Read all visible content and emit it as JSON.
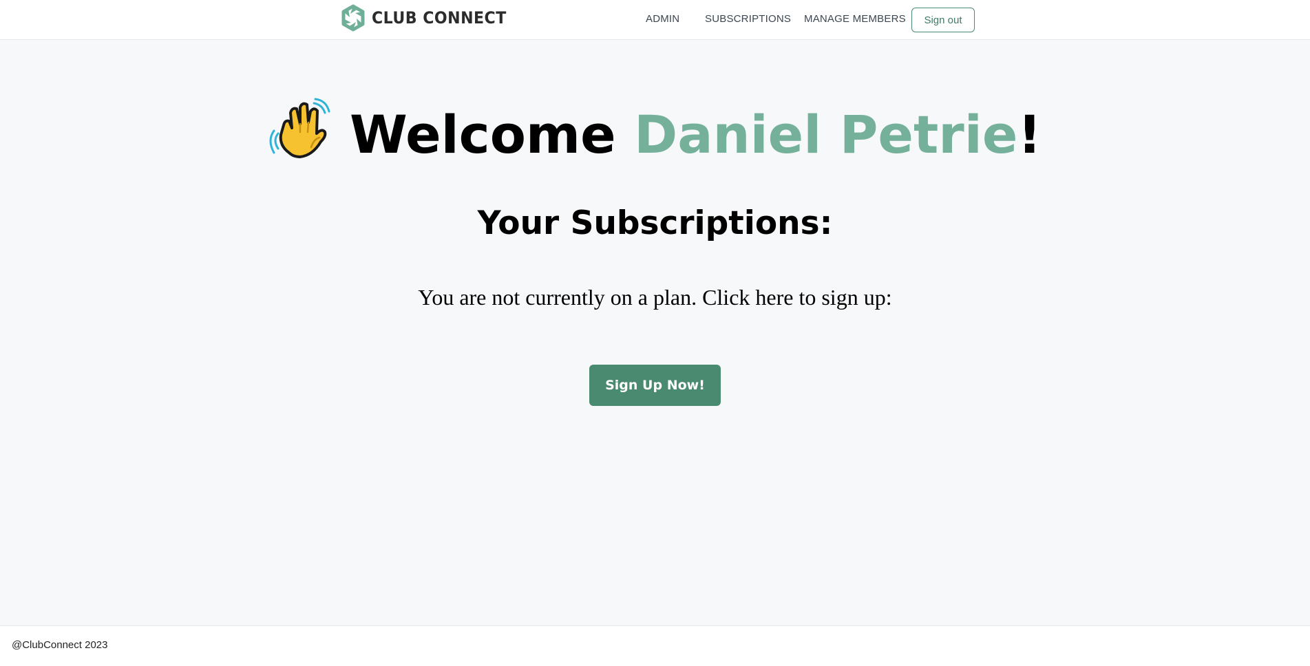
{
  "header": {
    "brand": "CLUB CONNECT",
    "nav": [
      {
        "label": "ADMIN"
      },
      {
        "label": "SUBSCRIPTIONS"
      },
      {
        "label": "MANAGE MEMBERS"
      }
    ],
    "signout_label": "Sign out"
  },
  "main": {
    "welcome_prefix": "Welcome ",
    "user_name": "Daniel Petrie",
    "welcome_suffix": "!",
    "emoji_icon": "waving-hand-icon",
    "subscriptions_title": "Your Subscriptions:",
    "plan_message": "You are not currently on a plan. Click here to sign up:",
    "signup_label": "Sign Up Now!"
  },
  "footer": {
    "copyright": "@ClubConnect 2023"
  },
  "colors": {
    "accent": "#74b09a",
    "button": "#4a8a70",
    "background": "#f7f8f9"
  }
}
